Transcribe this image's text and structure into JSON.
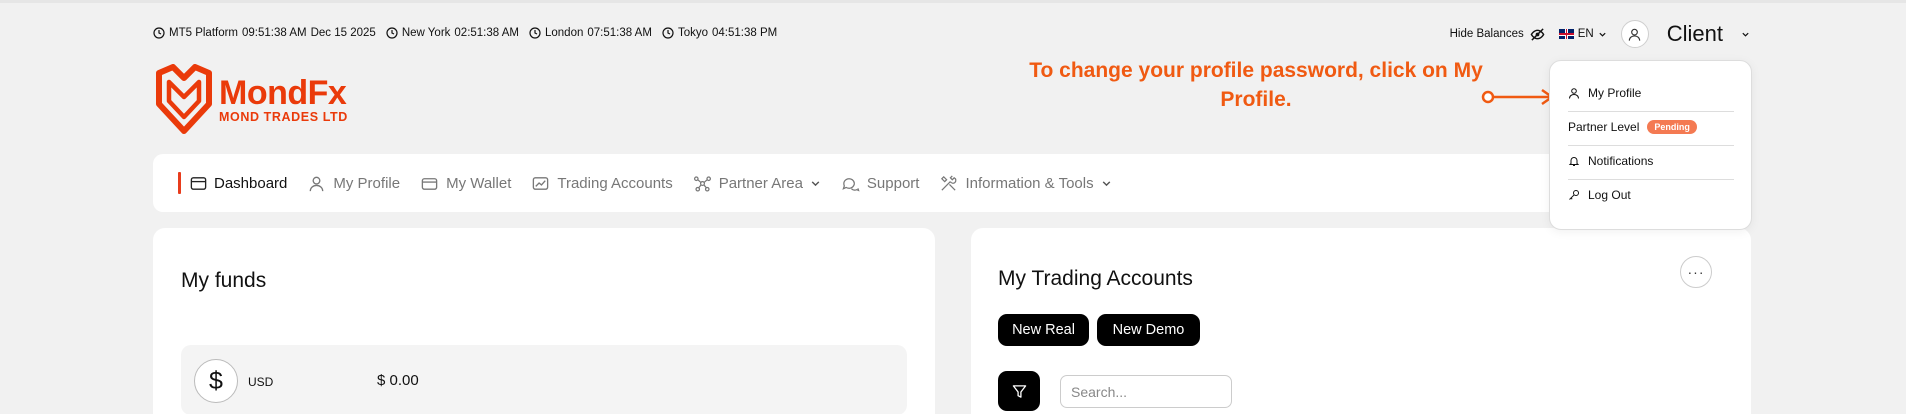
{
  "clocks": [
    {
      "label": "MT5 Platform",
      "time": "09:51:38 AM",
      "date": "Dec 15 2025"
    },
    {
      "label": "New York",
      "time": "02:51:38 AM"
    },
    {
      "label": "London",
      "time": "07:51:38 AM"
    },
    {
      "label": "Tokyo",
      "time": "04:51:38 PM"
    }
  ],
  "header": {
    "hide_balances": "Hide Balances",
    "language": "EN",
    "user": "Client"
  },
  "logo": {
    "name": "MondFx",
    "subtitle": "MOND TRADES LTD"
  },
  "annotation": {
    "text": "To change your profile password, click on My Profile."
  },
  "nav": [
    {
      "label": "Dashboard",
      "icon": "dashboard-icon"
    },
    {
      "label": "My Profile",
      "icon": "user-icon"
    },
    {
      "label": "My Wallet",
      "icon": "wallet-icon"
    },
    {
      "label": "Trading Accounts",
      "icon": "chart-icon"
    },
    {
      "label": "Partner Area",
      "icon": "network-icon"
    },
    {
      "label": "Support",
      "icon": "chat-icon"
    },
    {
      "label": "Information & Tools",
      "icon": "tools-icon"
    }
  ],
  "funds": {
    "title": "My funds",
    "currency_symbol": "$",
    "currency": "USD",
    "amount": "$ 0.00"
  },
  "trading": {
    "title": "My Trading Accounts",
    "more": "···",
    "new_real": "New Real",
    "new_demo": "New Demo",
    "search_placeholder": "Search..."
  },
  "dropdown": {
    "my_profile": "My Profile",
    "partner_level": "Partner Level",
    "partner_badge": "Pending",
    "notifications": "Notifications",
    "logout": "Log Out"
  },
  "colors": {
    "brand": "#ea3a0a",
    "annotation": "#f05a12",
    "badge": "#f47a52"
  }
}
